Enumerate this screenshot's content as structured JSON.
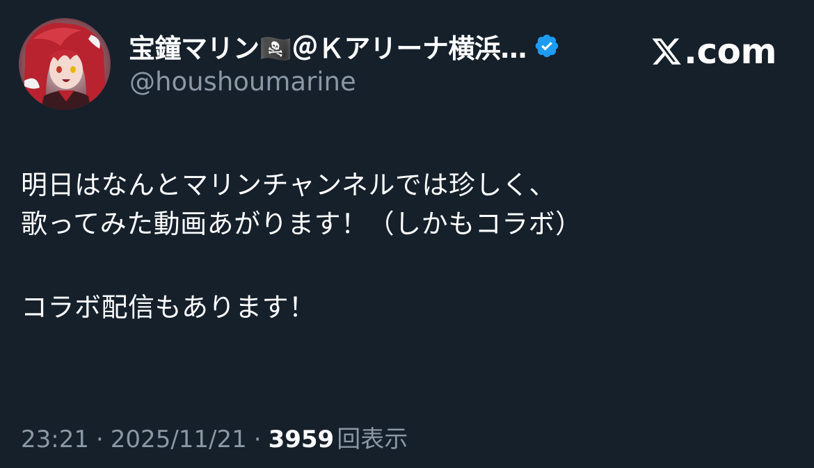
{
  "author": {
    "display_name": "宝鐘マリン🏴‍☠️＠Ｋアリーナ横浜…",
    "handle": "@houshoumarine",
    "verified": true,
    "avatar_icon": "anime-character-avatar"
  },
  "brand": {
    "logo_icon": "x-logo-icon",
    "label": ".com"
  },
  "tweet": {
    "lines": [
      "明日はなんとマリンチャンネルでは珍しく、",
      "歌ってみた動画あがります！（しかもコラボ）",
      "コラボ配信もあります！"
    ]
  },
  "meta": {
    "time": "23:21",
    "separator": "·",
    "date": "2025/11/21",
    "views_count": "3959",
    "views_label": "回表示"
  },
  "colors": {
    "background": "#15202b",
    "text_primary": "#ffffff",
    "text_secondary": "#8b98a5",
    "verified_blue": "#1d9bf0"
  }
}
